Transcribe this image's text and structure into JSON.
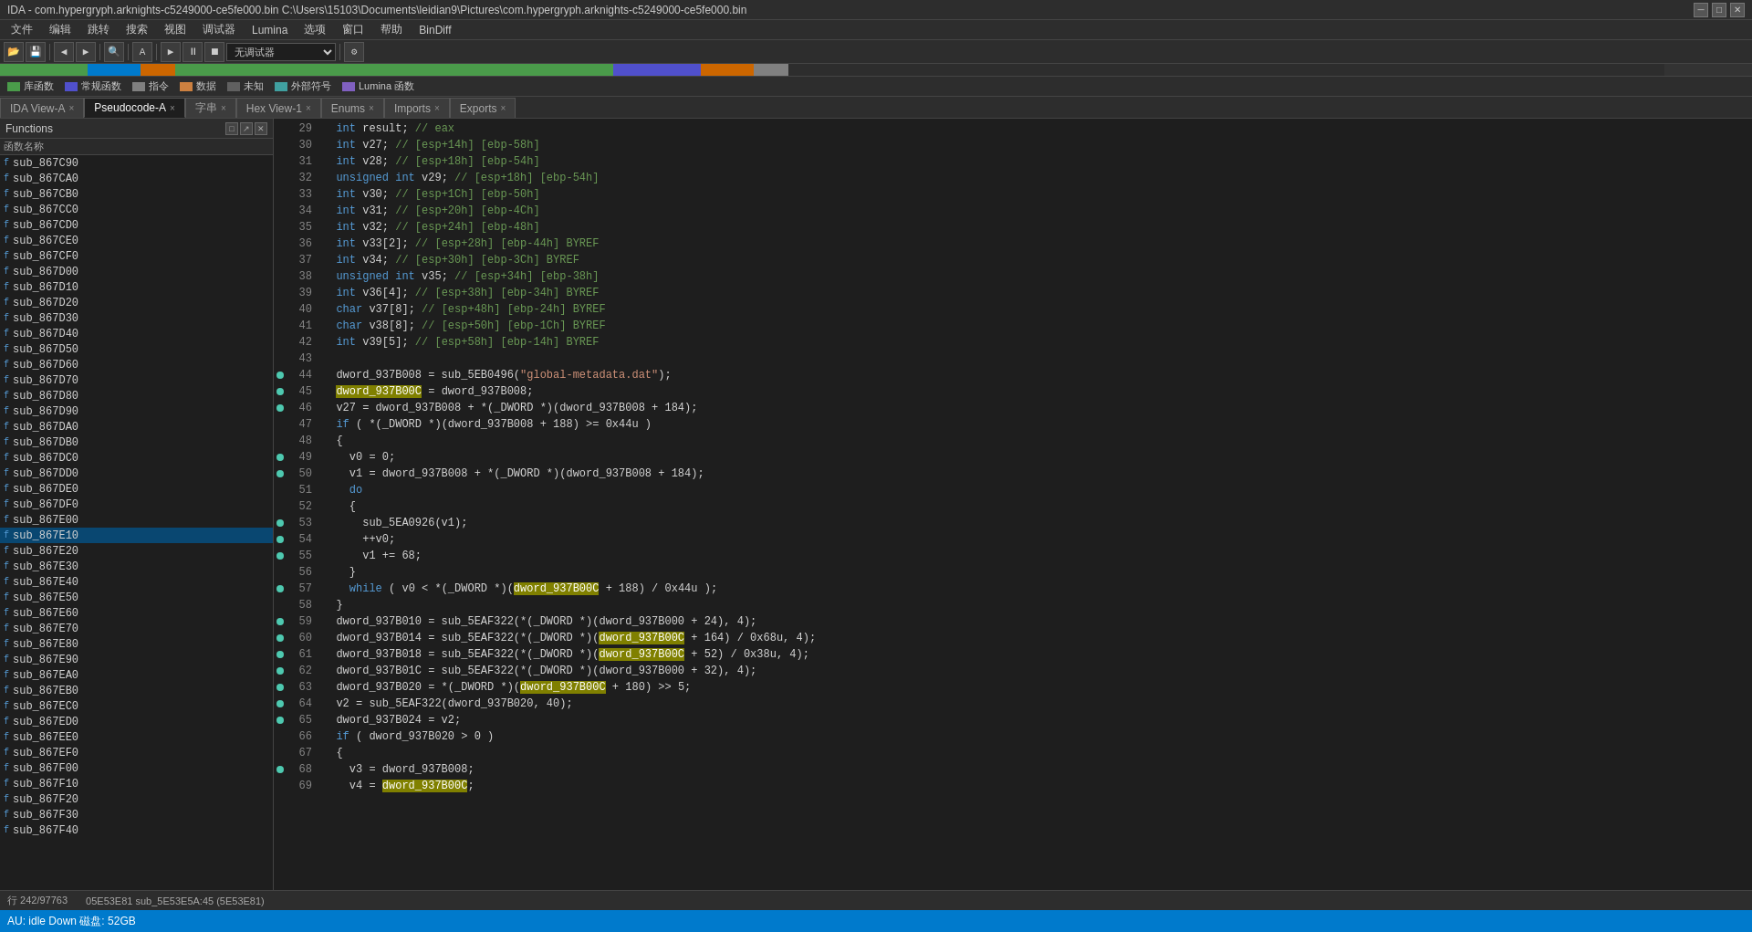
{
  "titlebar": {
    "title": "IDA - com.hypergryph.arknights-c5249000-ce5fe000.bin C:\\Users\\15103\\Documents\\leidian9\\Pictures\\com.hypergryph.arknights-c5249000-ce5fe000.bin",
    "minimize": "─",
    "maximize": "□",
    "close": "✕"
  },
  "menubar": {
    "items": [
      "文件",
      "编辑",
      "跳转",
      "搜索",
      "视图",
      "调试器",
      "Lumina",
      "选项",
      "窗口",
      "帮助",
      "BinDiff"
    ]
  },
  "legendbar": {
    "items": [
      {
        "color": "#4a9b4a",
        "label": "库函数"
      },
      {
        "color": "#5050cc",
        "label": "常规函数"
      },
      {
        "color": "#808080",
        "label": "指令"
      },
      {
        "color": "#cc8040",
        "label": "数据"
      },
      {
        "color": "#606060",
        "label": "未知"
      },
      {
        "color": "#40a0a0",
        "label": "外部符号"
      },
      {
        "color": "#8060c0",
        "label": "Lumina 函数"
      }
    ]
  },
  "tabs": [
    {
      "id": "ida-view-a",
      "label": "IDA View-A",
      "active": false,
      "closable": true
    },
    {
      "id": "pseudocode-a",
      "label": "Pseudocode-A",
      "active": true,
      "closable": true
    },
    {
      "id": "strings",
      "label": "字串",
      "active": false,
      "closable": true
    },
    {
      "id": "hex-view-1",
      "label": "Hex View-1",
      "active": false,
      "closable": true
    },
    {
      "id": "enums",
      "label": "Enums",
      "active": false,
      "closable": true
    },
    {
      "id": "imports",
      "label": "Imports",
      "active": false,
      "closable": true
    },
    {
      "id": "exports",
      "label": "Exports",
      "active": false,
      "closable": true
    }
  ],
  "functions_panel": {
    "title": "Functions",
    "col_header": "函数名称",
    "items": [
      "sub_867C90",
      "sub_867CA0",
      "sub_867CB0",
      "sub_867CC0",
      "sub_867CD0",
      "sub_867CE0",
      "sub_867CF0",
      "sub_867D00",
      "sub_867D10",
      "sub_867D20",
      "sub_867D30",
      "sub_867D40",
      "sub_867D50",
      "sub_867D60",
      "sub_867D70",
      "sub_867D80",
      "sub_867D90",
      "sub_867DA0",
      "sub_867DB0",
      "sub_867DC0",
      "sub_867DD0",
      "sub_867DE0",
      "sub_867DF0",
      "sub_867E00",
      "sub_867E10",
      "sub_867E20",
      "sub_867E30",
      "sub_867E40",
      "sub_867E50",
      "sub_867E60",
      "sub_867E70",
      "sub_867E80",
      "sub_867E90",
      "sub_867EA0",
      "sub_867EB0",
      "sub_867EC0",
      "sub_867ED0",
      "sub_867EE0",
      "sub_867EF0",
      "sub_867F00",
      "sub_867F10",
      "sub_867F20",
      "sub_867F30",
      "sub_867F40"
    ],
    "selected": "sub_867E10"
  },
  "code_lines": [
    {
      "num": 29,
      "bullet": false,
      "code": "  <kw>int</kw> result; <cm>// eax</cm>"
    },
    {
      "num": 30,
      "bullet": false,
      "code": "  <kw>int</kw> v27; <cm>// [esp+14h] [ebp-58h]</cm>"
    },
    {
      "num": 31,
      "bullet": false,
      "code": "  <kw>int</kw> v28; <cm>// [esp+18h] [ebp-54h]</cm>"
    },
    {
      "num": 32,
      "bullet": false,
      "code": "  <kw>unsigned</kw> <kw>int</kw> v29; <cm>// [esp+18h] [ebp-54h]</cm>"
    },
    {
      "num": 33,
      "bullet": false,
      "code": "  <kw>int</kw> v30; <cm>// [esp+1Ch] [ebp-50h]</cm>"
    },
    {
      "num": 34,
      "bullet": false,
      "code": "  <kw>int</kw> v31; <cm>// [esp+20h] [ebp-4Ch]</cm>"
    },
    {
      "num": 35,
      "bullet": false,
      "code": "  <kw>int</kw> v32; <cm>// [esp+24h] [ebp-48h]</cm>"
    },
    {
      "num": 36,
      "bullet": false,
      "code": "  <kw>int</kw> v33[2]; <cm>// [esp+28h] [ebp-44h] BYREF</cm>"
    },
    {
      "num": 37,
      "bullet": false,
      "code": "  <kw>int</kw> v34; <cm>// [esp+30h] [ebp-3Ch] BYREF</cm>"
    },
    {
      "num": 38,
      "bullet": false,
      "code": "  <kw>unsigned</kw> <kw>int</kw> v35; <cm>// [esp+34h] [ebp-38h]</cm>"
    },
    {
      "num": 39,
      "bullet": false,
      "code": "  <kw>int</kw> v36[4]; <cm>// [esp+38h] [ebp-34h] BYREF</cm>"
    },
    {
      "num": 40,
      "bullet": false,
      "code": "  <kw>char</kw> v37[8]; <cm>// [esp+48h] [ebp-24h] BYREF</cm>"
    },
    {
      "num": 41,
      "bullet": false,
      "code": "  <kw>char</kw> v38[8]; <cm>// [esp+50h] [ebp-1Ch] BYREF</cm>"
    },
    {
      "num": 42,
      "bullet": false,
      "code": "  <kw>int</kw> v39[5]; <cm>// [esp+58h] [ebp-14h] BYREF</cm>"
    },
    {
      "num": 43,
      "bullet": false,
      "code": ""
    },
    {
      "num": 44,
      "bullet": true,
      "code": "  dword_937B008 = sub_5EB0496(<str>\"global-metadata.dat\"</str>);"
    },
    {
      "num": 45,
      "bullet": true,
      "code": "  <hl>dword_937B00C</hl> = dword_937B008;"
    },
    {
      "num": 46,
      "bullet": true,
      "code": "  v27 = dword_937B008 + *(_DWORD *)(dword_937B008 + 184);"
    },
    {
      "num": 47,
      "bullet": false,
      "code": "  <kw>if</kw> ( *(_DWORD *)(dword_937B008 + 188) >= 0x44u )"
    },
    {
      "num": 48,
      "bullet": false,
      "code": "  {"
    },
    {
      "num": 49,
      "bullet": true,
      "code": "    v0 = 0;"
    },
    {
      "num": 50,
      "bullet": true,
      "code": "    v1 = dword_937B008 + *(_DWORD *)(dword_937B008 + 184);"
    },
    {
      "num": 51,
      "bullet": false,
      "code": "    <kw>do</kw>"
    },
    {
      "num": 52,
      "bullet": false,
      "code": "    {"
    },
    {
      "num": 53,
      "bullet": true,
      "code": "      sub_5EA0926(v1);"
    },
    {
      "num": 54,
      "bullet": true,
      "code": "      ++v0;"
    },
    {
      "num": 55,
      "bullet": true,
      "code": "      v1 += 68;"
    },
    {
      "num": 56,
      "bullet": false,
      "code": "    }"
    },
    {
      "num": 57,
      "bullet": true,
      "code": "    <kw>while</kw> ( v0 < *(_DWORD *)(<hl>dword_937B00C</hl> + 188) / 0x44u );"
    },
    {
      "num": 58,
      "bullet": false,
      "code": "  }"
    },
    {
      "num": 59,
      "bullet": true,
      "code": "  dword_937B010 = sub_5EAF322(*(_DWORD *)(dword_937B000 + 24), 4);"
    },
    {
      "num": 60,
      "bullet": true,
      "code": "  dword_937B014 = sub_5EAF322(*(_DWORD *)(<hl>dword_937B00C</hl> + 164) / 0x68u, 4);"
    },
    {
      "num": 61,
      "bullet": true,
      "code": "  dword_937B018 = sub_5EAF322(*(_DWORD *)(<hl>dword_937B00C</hl> + 52) / 0x38u, 4);"
    },
    {
      "num": 62,
      "bullet": true,
      "code": "  dword_937B01C = sub_5EAF322(*(_DWORD *)(dword_937B000 + 32), 4);"
    },
    {
      "num": 63,
      "bullet": true,
      "code": "  dword_937B020 = *(_DWORD *)(<hl>dword_937B00C</hl> + 180) >> 5;"
    },
    {
      "num": 64,
      "bullet": true,
      "code": "  v2 = sub_5EAF322(dword_937B020, 40);"
    },
    {
      "num": 65,
      "bullet": true,
      "code": "  dword_937B024 = v2;"
    },
    {
      "num": 66,
      "bullet": false,
      "code": "  <kw>if</kw> ( dword_937B020 > 0 )"
    },
    {
      "num": 67,
      "bullet": false,
      "code": "  {"
    },
    {
      "num": 68,
      "bullet": true,
      "code": "    v3 = dword_937B008;"
    },
    {
      "num": 69,
      "bullet": false,
      "code": "    v4 = <hl>dword_937B00C</hl>;"
    }
  ],
  "statusbar": {
    "row_col": "行 242/97763",
    "au": "AU:  idle  Down  磁盘: 52GB",
    "address_info": "05E53E81 sub_5E53E5A:45 (5E53E81)"
  }
}
